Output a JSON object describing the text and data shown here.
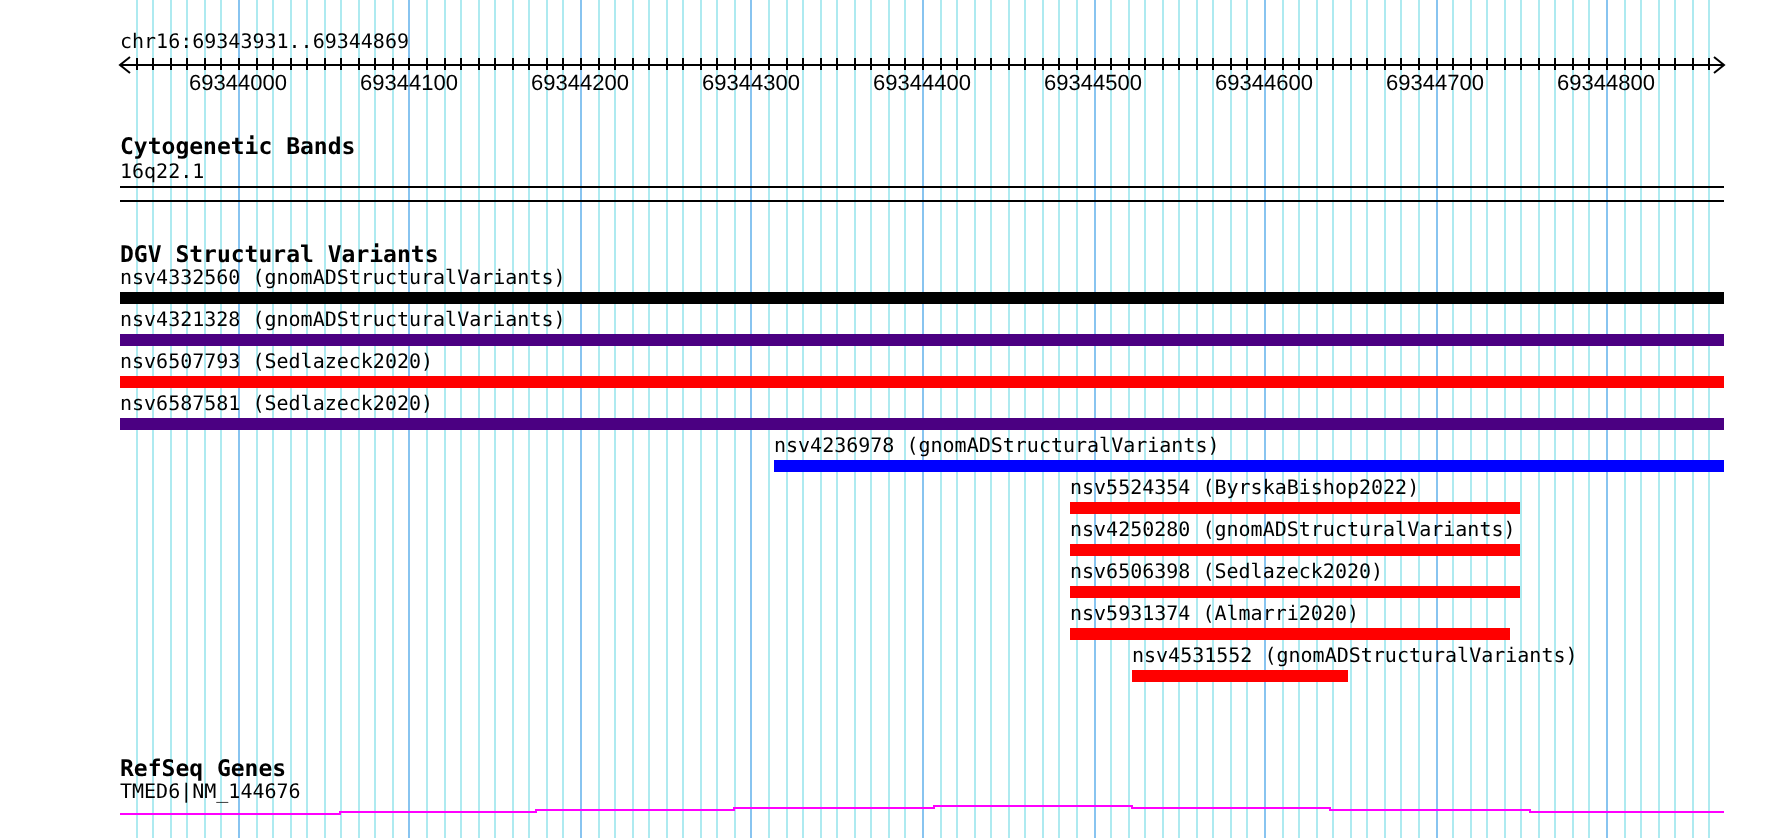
{
  "ruler": {
    "label": "chr16:69343931..69344869",
    "ticks": [
      "69344000",
      "69344100",
      "69344200",
      "69344300",
      "69344400",
      "69344500",
      "69344600",
      "69344700",
      "69344800"
    ]
  },
  "cytogenetic_bands": {
    "title": "Cytogenetic Bands",
    "band": "16q22.1"
  },
  "dgv_structural_variants": {
    "title": "DGV Structural Variants",
    "features": [
      {
        "label": "nsv4332560 (gnomADStructuralVariants)",
        "color": "#000000"
      },
      {
        "label": "nsv4321328 (gnomADStructuralVariants)",
        "color": "#4b0082"
      },
      {
        "label": "nsv6507793 (Sedlazeck2020)",
        "color": "#ff0000"
      },
      {
        "label": "nsv6587581 (Sedlazeck2020)",
        "color": "#4b0082"
      },
      {
        "label": "nsv4236978 (gnomADStructuralVariants)",
        "color": "#0000ff"
      },
      {
        "label": "nsv5524354 (ByrskaBishop2022)",
        "color": "#ff0000"
      },
      {
        "label": "nsv4250280 (gnomADStructuralVariants)",
        "color": "#ff0000"
      },
      {
        "label": "nsv6506398 (Sedlazeck2020)",
        "color": "#ff0000"
      },
      {
        "label": "nsv5931374 (Almarri2020)",
        "color": "#ff0000"
      },
      {
        "label": "nsv4531552 (gnomADStructuralVariants)",
        "color": "#ff0000"
      }
    ]
  },
  "refseq_genes": {
    "title": "RefSeq Genes",
    "gene": "TMED6|NM_144676"
  }
}
